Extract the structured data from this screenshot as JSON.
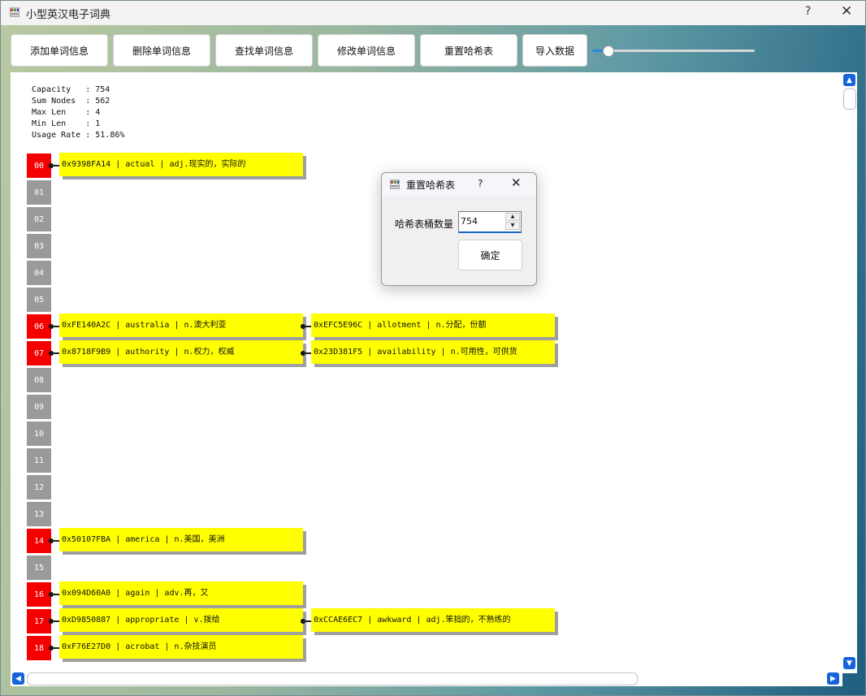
{
  "window": {
    "title": "小型英汉电子词典",
    "help_glyph": "?",
    "close_glyph": "✕"
  },
  "toolbar": {
    "add_label": "添加单词信息",
    "delete_label": "删除单词信息",
    "find_label": "查找单词信息",
    "modify_label": "修改单词信息",
    "reset_label": "重置哈希表",
    "import_label": "导入数据",
    "slider_value_fraction": 0.1
  },
  "stats": {
    "capacity": "Capacity   : 754",
    "sum_nodes": "Sum Nodes  : 562",
    "max_len": "Max Len    : 4",
    "min_len": "Min Len    : 1",
    "usage_rate": "Usage Rate : 51.86%"
  },
  "buckets": [
    {
      "label": "00",
      "filled": true,
      "nodes": [
        "0x9398FA14 | actual | adj.现实的，实际的"
      ]
    },
    {
      "label": "01",
      "filled": false,
      "nodes": []
    },
    {
      "label": "02",
      "filled": false,
      "nodes": []
    },
    {
      "label": "03",
      "filled": false,
      "nodes": []
    },
    {
      "label": "04",
      "filled": false,
      "nodes": []
    },
    {
      "label": "05",
      "filled": false,
      "nodes": []
    },
    {
      "label": "06",
      "filled": true,
      "nodes": [
        "0xFE140A2C | australia | n.澳大利亚",
        "0xEFC5E96C | allotment | n.分配，份额"
      ]
    },
    {
      "label": "07",
      "filled": true,
      "nodes": [
        "0x8718F9B9 | authority | n.权力，权威",
        "0x23D381F5 | availability | n.可用性，可供货"
      ]
    },
    {
      "label": "08",
      "filled": false,
      "nodes": []
    },
    {
      "label": "09",
      "filled": false,
      "nodes": []
    },
    {
      "label": "10",
      "filled": false,
      "nodes": []
    },
    {
      "label": "11",
      "filled": false,
      "nodes": []
    },
    {
      "label": "12",
      "filled": false,
      "nodes": []
    },
    {
      "label": "13",
      "filled": false,
      "nodes": []
    },
    {
      "label": "14",
      "filled": true,
      "nodes": [
        "0x50107FBA | america | n.美国，美洲"
      ]
    },
    {
      "label": "15",
      "filled": false,
      "nodes": []
    },
    {
      "label": "16",
      "filled": true,
      "nodes": [
        "0x094D60A0 | again | adv.再，又"
      ]
    },
    {
      "label": "17",
      "filled": true,
      "nodes": [
        "0xD9850887 | appropriate | v.拨给",
        "0xCCAE6EC7 | awkward | adj.笨拙的，不熟练的"
      ]
    },
    {
      "label": "18",
      "filled": true,
      "nodes": [
        "0xF76E27D0 | acrobat | n.杂技演员"
      ]
    }
  ],
  "colors": {
    "bucket_filled": "#f40000",
    "bucket_empty": "#9a9a9a",
    "node_bg": "#ffff00",
    "accent": "#1565d8"
  },
  "dialog": {
    "title": "重置哈希表",
    "help_glyph": "?",
    "close_glyph": "✕",
    "field_label": "哈希表桶数量",
    "field_value": "754",
    "ok_label": "确定"
  },
  "icons": {
    "app": "dictionary-icon",
    "scroll_up": "arrow-up-icon",
    "scroll_down": "arrow-down-icon",
    "scroll_left": "arrow-left-icon",
    "scroll_right": "arrow-right-icon"
  }
}
